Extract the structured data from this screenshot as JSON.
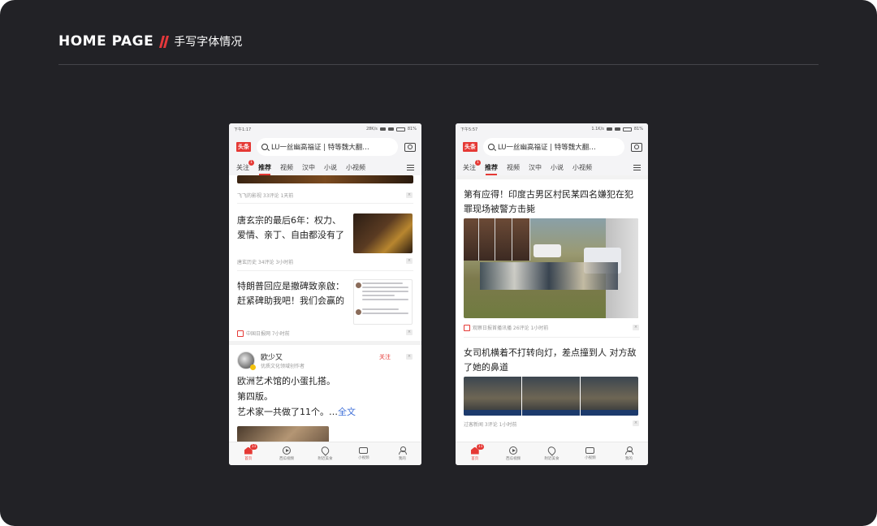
{
  "header": {
    "title": "HOME PAGE",
    "subtitle": "手写字体情况"
  },
  "common": {
    "logo": "头条",
    "search_text": "LU一丝幽高福证 | 特等魏大翻…",
    "tabs": [
      "关注",
      "推荐",
      "视频",
      "汉中",
      "小说",
      "小视频"
    ],
    "tab_badge": "1",
    "nav": [
      "首页",
      "西瓜视频",
      "附近美食",
      "小视频",
      "我的"
    ],
    "nav_badge": "11",
    "close_glyph": "×"
  },
  "left": {
    "status": {
      "time": "下午1:17",
      "net": "28K/s",
      "battery": "81%"
    },
    "items": [
      {
        "meta": "飞飞的影视 33评论 1天前"
      },
      {
        "headline": "唐玄宗的最后6年：权力、爱情、亲丁、自由都没有了",
        "meta": "唐玄历史 34评论 3小时前"
      },
      {
        "headline": "特朗普回应是撤碑致亲啟：赶紧碑助我吧！我们会赢的",
        "meta": "中国日报网 7小时前"
      }
    ],
    "post": {
      "user": "欧少又",
      "desc": "优质文化领域创作者",
      "follow": "关注",
      "lines": [
        "欧洲艺术馆的小蛋扎搭。",
        "第四版。",
        "艺术家一共做了11个。…"
      ],
      "more": "全文"
    }
  },
  "right": {
    "status": {
      "time": "下午5:57",
      "net": "1.1K/s",
      "battery": "81%"
    },
    "items": [
      {
        "headline": "第有应得！印度古男区村民某四名嫌犯在犯罪现场被警方击毙",
        "meta": "观察日报首播讯播 26评论 1小时前"
      },
      {
        "headline": "女司机横着不打转向灯，差点撞到人 对方敌了她的鼻道",
        "meta": "过客新闻 3评论 1小时前"
      }
    ]
  }
}
